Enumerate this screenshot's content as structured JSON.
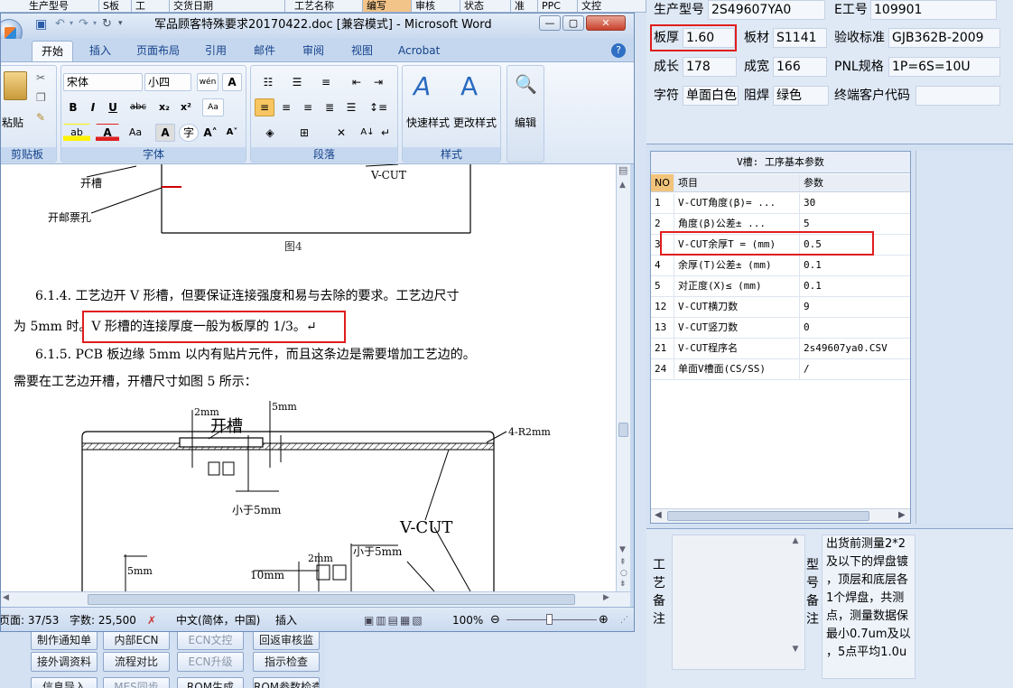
{
  "background_app": {
    "top_headers": [
      "生产型号",
      "S板",
      "工",
      "交货日期",
      "工艺名称",
      "编写",
      "审核",
      "状态",
      "准",
      "PPC",
      "文控"
    ],
    "bottom_buttons": [
      [
        "制作通知单",
        "内部ECN",
        "ECN文控",
        "回返审核监"
      ],
      [
        "接外调资料",
        "流程对比",
        "ECN升级",
        "指示检查"
      ],
      [
        "信息导入",
        "MES同步",
        "ROM生成",
        "ROM参数检查"
      ]
    ]
  },
  "right_form": {
    "fields": {
      "model_label": "生产型号",
      "model_value": "2S49607YA0",
      "eng_label": "E工号",
      "eng_value": "109901",
      "thickness_label": "板厚",
      "thickness_value": "1.60",
      "material_label": "板材",
      "material_value": "S1141",
      "standard_label": "验收标准",
      "standard_value": "GJB362B-2009",
      "length_label": "成长",
      "length_value": "178",
      "width_label": "成宽",
      "width_value": "166",
      "pnl_label": "PNL规格",
      "pnl_value": "1P=6S=10U",
      "char_label": "字符",
      "char_value": "单面白色",
      "solder_label": "阻焊",
      "solder_value": "绿色",
      "customer_label": "终端客户代码",
      "customer_value": ""
    }
  },
  "vgroove_table": {
    "title": "V槽: 工序基本参数",
    "columns": [
      "NO",
      "项目",
      "参数"
    ],
    "rows": [
      {
        "no": "1",
        "item": "V-CUT角度(β)= ...",
        "value": "30"
      },
      {
        "no": "2",
        "item": "角度(β)公差± ...",
        "value": "5"
      },
      {
        "no": "3",
        "item": "V-CUT余厚T = (mm)",
        "value": "0.5"
      },
      {
        "no": "4",
        "item": "余厚(T)公差± (mm)",
        "value": "0.1"
      },
      {
        "no": "5",
        "item": "对正度(X)≤ (mm)",
        "value": "0.1"
      },
      {
        "no": "12",
        "item": "V-CUT横刀数",
        "value": "9"
      },
      {
        "no": "13",
        "item": "V-CUT竖刀数",
        "value": "0"
      },
      {
        "no": "21",
        "item": "V-CUT程序名",
        "value": "2s49607ya0.CSV"
      },
      {
        "no": "24",
        "item": "单面V槽面(CS/SS)",
        "value": "/"
      }
    ]
  },
  "remarks": {
    "process_label": "工艺备注",
    "model_label": "型号备注",
    "model_remark_lines": [
      "出货前测量2*2",
      "及以下的焊盘镀",
      "，顶层和底层各",
      "1个焊盘，共测",
      "点，测量数据保",
      "最小0.7um及以",
      "，5点平均1.0u"
    ]
  },
  "word": {
    "title": "军品顾客特殊要求20170422.doc [兼容模式] - Microsoft Word",
    "tabs": [
      "开始",
      "插入",
      "页面布局",
      "引用",
      "邮件",
      "审阅",
      "视图",
      "Acrobat"
    ],
    "ribbon": {
      "paste": "粘贴",
      "clipboard": "剪贴板",
      "font_name": "宋体",
      "font_size": "小四",
      "font_group": "字体",
      "paragraph_group": "段落",
      "quick_styles": "快速样式",
      "change_styles": "更改样式",
      "styles_group": "样式",
      "editing": "编辑"
    },
    "document": {
      "fig4_labels": {
        "slot": "开槽",
        "stamp_hole": "开邮票孔",
        "vcut": "V-CUT",
        "caption": "图4"
      },
      "para_614_a": "6.1.4. 工艺边开 V 形槽，但要保证连接强度和易与去除的要求。工艺边尺寸",
      "para_614_b_pre": "为 5mm 时。",
      "para_614_b_highlight": "V 形槽的连接厚度一般为板厚的 1/3。↵",
      "para_615_a": "6.1.5. PCB 板边缘 5mm 以内有贴片元件，而且这条边是需要增加工艺边的。",
      "para_615_b": "需要在工艺边开槽，开槽尺寸如图 5 所示：",
      "fig5_labels": {
        "d2mm": "2mm",
        "slot": "开槽",
        "d5mm": "5mm",
        "radius": "4-R2mm",
        "less5": "小于5mm",
        "vcut": "V-CUT",
        "d5mm_b": "5mm",
        "d10mm": "10mm",
        "d2mm_b": "2mm",
        "less5_b": "小于5mm"
      }
    },
    "status": {
      "page": "页面: 37/53",
      "words": "字数: 25,500",
      "lang": "中文(简体，中国)",
      "mode": "插入",
      "zoom": "100%"
    }
  }
}
